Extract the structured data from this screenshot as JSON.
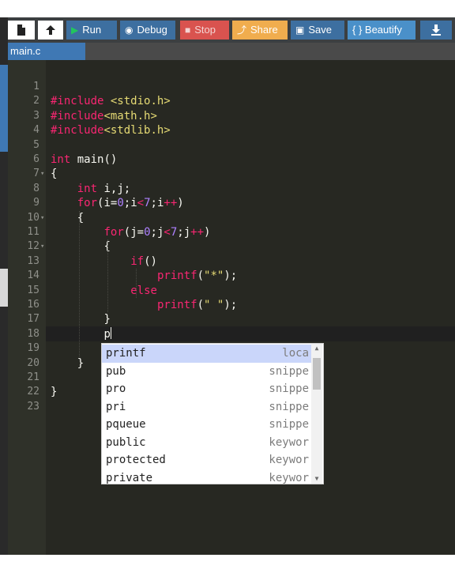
{
  "colors": {
    "editor_bg": "#272822",
    "gutter_bg": "#2f3129",
    "tab_active": "#3f78b4",
    "run_icon": "#22c55e",
    "stop_btn": "#d9534f",
    "share_btn": "#f0ad4e",
    "selected_suggestion": "#cad6fa"
  },
  "toolbar": {
    "new_file_icon": "file-icon",
    "upload_icon": "upload-icon",
    "run_label": "Run",
    "run_icon": "play-icon",
    "debug_label": "Debug",
    "debug_icon": "bug-icon",
    "stop_label": "Stop",
    "stop_icon": "square-icon",
    "share_label": "Share",
    "share_icon": "share-icon",
    "save_label": "Save",
    "save_icon": "floppy-icon",
    "beautify_label": "{ } Beautify",
    "download_icon": "download-icon"
  },
  "tab": {
    "label": "main.c"
  },
  "editor": {
    "line_numbers": [
      "1",
      "2",
      "3",
      "4",
      "5",
      "6",
      "7",
      "8",
      "9",
      "10",
      "11",
      "12",
      "13",
      "14",
      "15",
      "16",
      "17",
      "18",
      "19",
      "20",
      "21",
      "22",
      "23"
    ],
    "folded_lines": [
      "7",
      "10",
      "12"
    ],
    "code_lines": [
      "",
      "#include <stdio.h>",
      "#include<math.h>",
      "#include<stdlib.h>",
      "",
      "int main()",
      "{",
      "    int i,j;",
      "    for(i=0;i<7;i++)",
      "    {",
      "        for(j=0;j<7;j++)",
      "        {",
      "            if()",
      "                printf(\"*\");",
      "            else",
      "                printf(\" \");",
      "        }",
      "        p",
      "",
      "    }",
      "",
      "}",
      ""
    ]
  },
  "autocomplete": {
    "items": [
      {
        "caption": "printf",
        "meta": "loca",
        "selected": true
      },
      {
        "caption": "pub",
        "meta": "snippe",
        "selected": false
      },
      {
        "caption": "pro",
        "meta": "snippe",
        "selected": false
      },
      {
        "caption": "pri",
        "meta": "snippe",
        "selected": false
      },
      {
        "caption": "pqueue",
        "meta": "snippe",
        "selected": false
      },
      {
        "caption": "public",
        "meta": "keywor",
        "selected": false
      },
      {
        "caption": "protected",
        "meta": "keywor",
        "selected": false
      },
      {
        "caption": "private",
        "meta": "keywor",
        "selected": false
      }
    ]
  }
}
